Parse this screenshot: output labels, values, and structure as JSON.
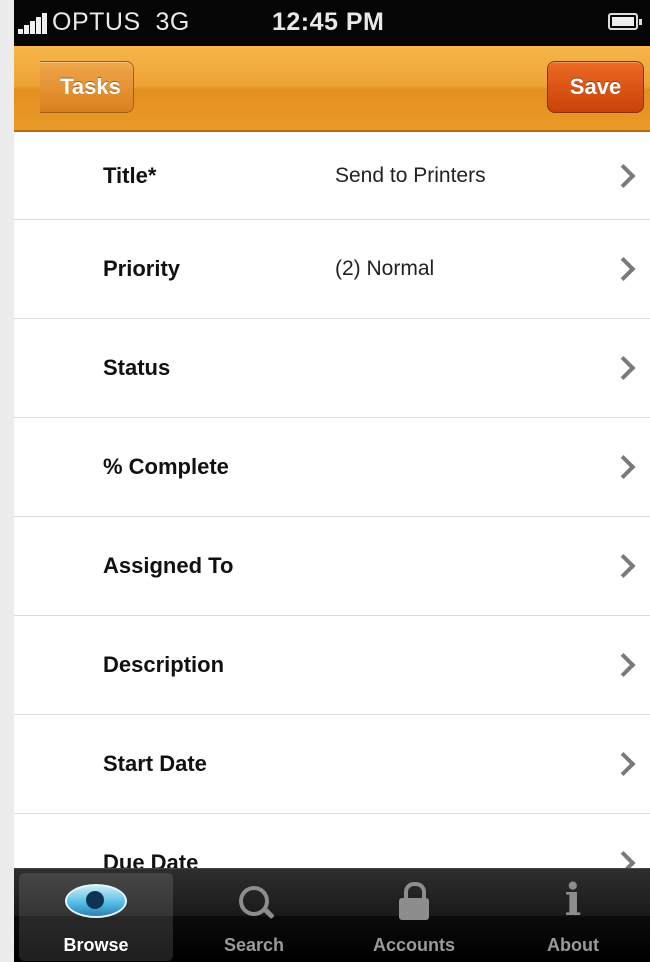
{
  "status_bar": {
    "carrier": "OPTUS",
    "network": "3G",
    "time": "12:45 PM"
  },
  "nav": {
    "back_label": "Tasks",
    "save_label": "Save"
  },
  "fields": [
    {
      "label": "Title*",
      "value": "Send to Printers"
    },
    {
      "label": "Priority",
      "value": "(2) Normal"
    },
    {
      "label": "Status",
      "value": ""
    },
    {
      "label": "% Complete",
      "value": ""
    },
    {
      "label": "Assigned To",
      "value": ""
    },
    {
      "label": "Description",
      "value": ""
    },
    {
      "label": "Start Date",
      "value": ""
    },
    {
      "label": "Due Date",
      "value": ""
    }
  ],
  "tabs": [
    {
      "label": "Browse",
      "icon": "eye-icon",
      "active": true
    },
    {
      "label": "Search",
      "icon": "search-icon",
      "active": false
    },
    {
      "label": "Accounts",
      "icon": "lock-icon",
      "active": false
    },
    {
      "label": "About",
      "icon": "info-icon",
      "active": false
    }
  ],
  "colors": {
    "nav_orange": "#eea235",
    "save_orange": "#d9531a",
    "tab_active_eye": "#4fb8e4"
  }
}
